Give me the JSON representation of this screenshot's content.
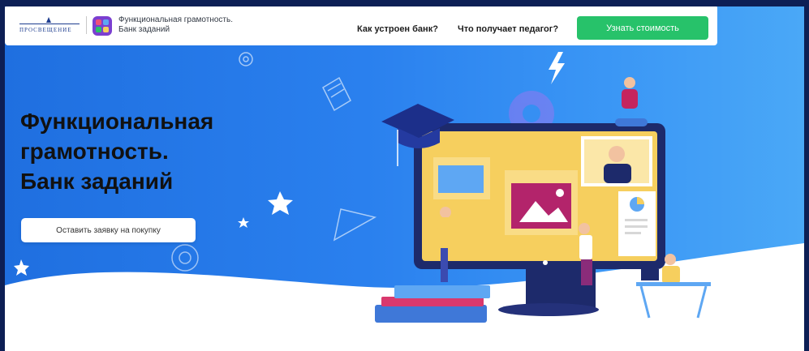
{
  "header": {
    "publisher_logo_text": "ПРОСВЕЩЕНИЕ",
    "brand_title_line1": "Функциональная грамотность.",
    "brand_title_line2": "Банк заданий",
    "nav": [
      {
        "label": "Как устроен банк?"
      },
      {
        "label": "Что получает педагог?"
      }
    ],
    "cta_label": "Узнать стоимость"
  },
  "hero": {
    "title_lines": [
      "Функциональная",
      "грамотность.",
      "Банк заданий"
    ],
    "apply_button_label": "Оставить заявку на покупку"
  },
  "colors": {
    "background_blue": "#2a80ee",
    "cta_green": "#27c26a",
    "app_icon_purple": "#7b3fd0",
    "monitor_screen": "#f6cf5e"
  },
  "icons": [
    "gear-icon",
    "lightning-icon",
    "book-icon",
    "star-icon",
    "graduation-cap-icon",
    "image-icon",
    "pie-chart-icon",
    "triangle-icon"
  ]
}
